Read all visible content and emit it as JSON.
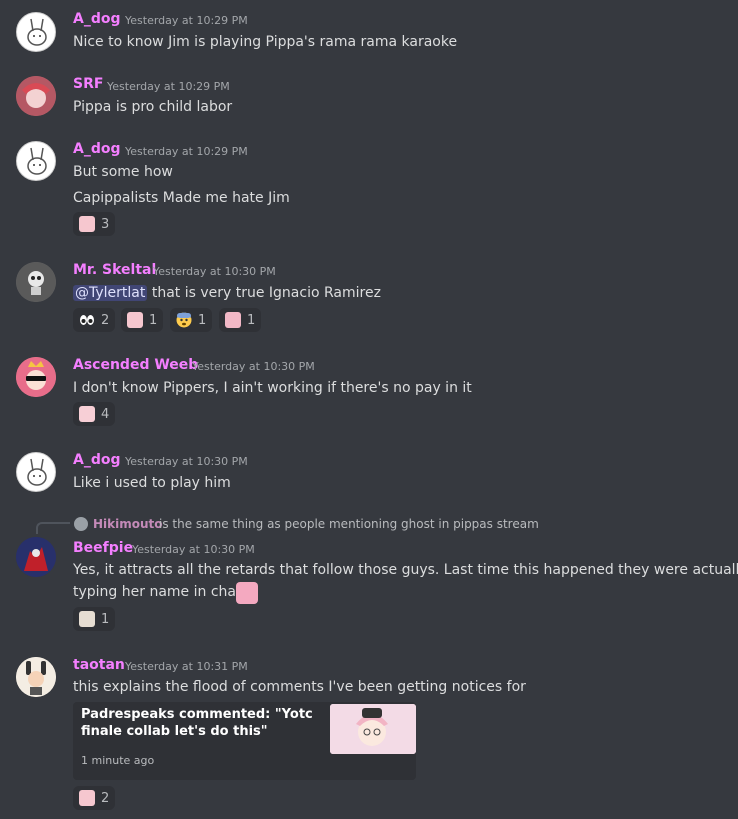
{
  "messages": [
    {
      "user": "A_dog",
      "time": "Yesterday at 10:29 PM",
      "lines": [
        "Nice to know Jim is playing Pippa's rama rama karaoke"
      ]
    },
    {
      "user": "SRF",
      "time": "Yesterday at 10:29 PM",
      "lines": [
        "Pippa is pro child labor"
      ]
    },
    {
      "user": "A_dog",
      "time": "Yesterday at 10:29 PM",
      "lines": [
        "But some how",
        "Capippalists Made me hate Jim"
      ],
      "reactions": [
        {
          "emoji": "pippa-face",
          "count": "3"
        }
      ]
    },
    {
      "user": "Mr. Skeltal",
      "time": "Yesterday at 10:30 PM",
      "mention": "@Tylertlat",
      "lines": [
        " that is very true Ignacio Ramirez"
      ],
      "reactions": [
        {
          "emoji": "eyes",
          "count": "2"
        },
        {
          "emoji": "pippa-face",
          "count": "1"
        },
        {
          "emoji": "fearful-face",
          "count": "1"
        },
        {
          "emoji": "pippa-sad",
          "count": "1"
        }
      ]
    },
    {
      "user": "Ascended Weeb",
      "time": "Yesterday at 10:30 PM",
      "lines": [
        "I don't know Pippers, I ain't working if there's no pay in it"
      ],
      "reactions": [
        {
          "emoji": "pippa-crown",
          "count": "4"
        }
      ]
    },
    {
      "user": "A_dog",
      "time": "Yesterday at 10:30 PM",
      "lines": [
        "Like i used to play him"
      ]
    },
    {
      "reply_user": "Hikimouto",
      "reply_text": "is the same thing as people mentioning ghost in pippas stream",
      "user": "Beefpie",
      "time": "Yesterday at 10:30 PM",
      "lines": [
        "Yes, it attracts all the retards that follow those guys. Last time this happened they were actually",
        "typing her name in chat."
      ],
      "reactions": [
        {
          "emoji": "bunny",
          "count": "1"
        }
      ]
    },
    {
      "user": "taotan",
      "time": "Yesterday at 10:31 PM",
      "lines": [
        "this explains the flood of comments I've been getting notices for"
      ],
      "embed": {
        "title": "Padrespeaks commented: \"Yotc finale collab let's do this\"",
        "time": "1 minute ago"
      },
      "reactions": [
        {
          "emoji": "pippa-face",
          "count": "2"
        }
      ]
    }
  ]
}
